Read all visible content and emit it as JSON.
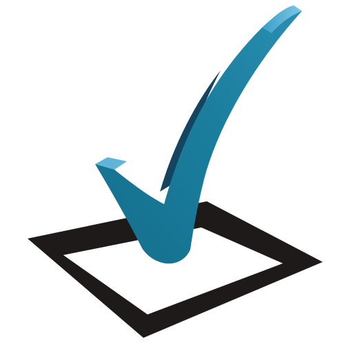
{
  "image": {
    "subject": "checkbox-with-checkmark",
    "icon": "checkmark-icon",
    "checked": true
  },
  "colors": {
    "background": "#ffffff",
    "box_border": "#1f1a1a",
    "box_fill": "#ffffff",
    "check_face": "#1c7f9f",
    "check_highlight": "#5fb4d8",
    "check_shadow": "#0f4d66"
  }
}
